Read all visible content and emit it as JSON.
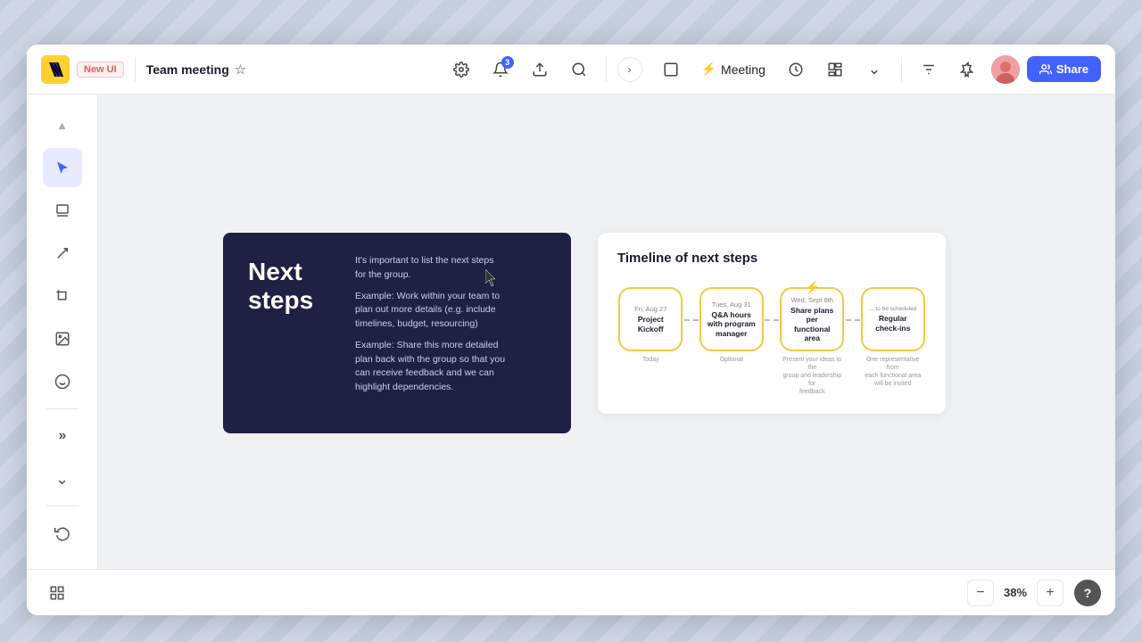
{
  "app": {
    "title": "Miro",
    "new_ui_label": "New UI",
    "board_title": "Team meeting",
    "share_label": "Share"
  },
  "topbar": {
    "notifications_count": "3",
    "meeting_label": "Meeting",
    "zoom_level": "38%"
  },
  "sidebar": {
    "tools": [
      {
        "name": "cursor",
        "icon": "▲",
        "active": true
      },
      {
        "name": "frame",
        "icon": "⊡"
      },
      {
        "name": "draw",
        "icon": "↗"
      },
      {
        "name": "crop",
        "icon": "⊞"
      },
      {
        "name": "image",
        "icon": "⊠"
      },
      {
        "name": "emoji",
        "icon": "☺"
      },
      {
        "name": "more",
        "icon": "»"
      },
      {
        "name": "expand",
        "icon": "⌄"
      }
    ]
  },
  "canvas": {
    "card1": {
      "title": "Next\nsteps",
      "paragraph1": "It's important to list the next steps\nfor the group.",
      "paragraph2": "Example: Work within your team to\nplan out more details (e.g. include\ntimelines, budget, resourcing)",
      "paragraph3": "Example: Share this more detailed\nplan back with the group so that you\ncan receive feedback and we can\nhighlight dependencies."
    },
    "card2": {
      "title": "Timeline of next steps",
      "items": [
        {
          "date": "Fri, Aug 27",
          "label": "Project\nKickoff",
          "sub": "Today"
        },
        {
          "date": "Tues, Aug 31",
          "label": "Q&A hours\nwith program\nmanager",
          "sub": "Optional"
        },
        {
          "date": "Wed, Sept 8th",
          "label": "Share plans per\nfunctional area",
          "sub": "Present your ideas to the\ngroup and leadership for\nfeedback",
          "has_lightning": true
        },
        {
          "date": "... to be scheduled",
          "label": "Regular\ncheck-ins",
          "sub": "One representative from\neach functional area\nwill be invited"
        }
      ]
    }
  },
  "bottombar": {
    "help_label": "?"
  }
}
